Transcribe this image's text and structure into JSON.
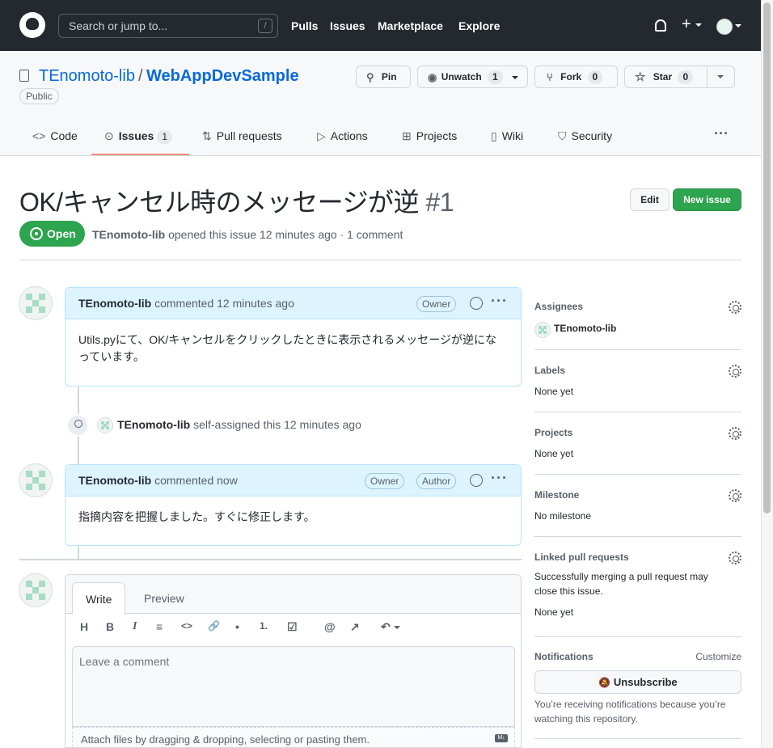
{
  "topnav": {
    "search_placeholder": "Search or jump to...",
    "search_shortcut": "/",
    "links": [
      "Pulls",
      "Issues",
      "Marketplace",
      "Explore"
    ],
    "plus": "+"
  },
  "repo": {
    "owner": "TEnomoto-lib",
    "separator": "/",
    "name": "WebAppDevSample",
    "visibility": "Public",
    "pin_label": "Pin",
    "unwatch_label": "Unwatch",
    "watch_count": "1",
    "fork_label": "Fork",
    "fork_count": "0",
    "star_label": "Star",
    "star_count": "0"
  },
  "tabs": [
    {
      "label": "Code",
      "icon": "code-icon"
    },
    {
      "label": "Issues",
      "icon": "issue-icon",
      "count": "1"
    },
    {
      "label": "Pull requests",
      "icon": "pull-request-icon"
    },
    {
      "label": "Actions",
      "icon": "play-icon"
    },
    {
      "label": "Projects",
      "icon": "table-icon"
    },
    {
      "label": "Wiki",
      "icon": "book-icon"
    },
    {
      "label": "Security",
      "icon": "shield-icon"
    }
  ],
  "more": "···",
  "issue": {
    "title": "OK/キャンセル時のメッセージが逆",
    "number": "#1",
    "edit_label": "Edit",
    "new_issue_label": "New issue",
    "state": "Open",
    "author": "TEnomoto-lib",
    "meta_text": "opened this issue 12 minutes ago · 1 comment"
  },
  "comments": [
    {
      "author": "TEnomoto-lib",
      "action": "commented 12 minutes ago",
      "badges": [
        "Owner"
      ],
      "body_line1": "Utils.pyにて、OK/キャンセルをクリックしたときに表示されるメッセージが逆にな",
      "body_line2": "っています。"
    },
    {
      "author": "TEnomoto-lib",
      "action": "commented now",
      "badges": [
        "Owner",
        "Author"
      ],
      "body_line1": "指摘内容を把握しました。すぐに修正します。"
    }
  ],
  "event": {
    "actor": "TEnomoto-lib",
    "text": "self-assigned this 12 minutes ago"
  },
  "editor": {
    "write_tab": "Write",
    "preview_tab": "Preview",
    "toolbar": [
      "H",
      "B",
      "I",
      "≡",
      "<>",
      "🔗",
      "•",
      "1.",
      "☑",
      "@",
      "↗",
      "↶"
    ],
    "placeholder": "Leave a comment",
    "attach_text": "Attach files by dragging & dropping, selecting or pasting them.",
    "md_badge": "M↓"
  },
  "sidebar": {
    "assignees_title": "Assignees",
    "assignee": "TEnomoto-lib",
    "labels_title": "Labels",
    "labels_value": "None yet",
    "projects_title": "Projects",
    "projects_value": "None yet",
    "milestone_title": "Milestone",
    "milestone_value": "No milestone",
    "linked_title": "Linked pull requests",
    "linked_desc_1": "Successfully merging a pull request may",
    "linked_desc_2": "close this issue.",
    "linked_value": "None yet",
    "notifications_title": "Notifications",
    "customize": "Customize",
    "unsubscribe": "Unsubscribe",
    "notif_desc_1": "You’re receiving notifications because you’re",
    "notif_desc_2": "watching this repository."
  },
  "colors": {
    "header_bg": "#24292f",
    "open_green": "#2da44e",
    "link_blue": "#0969da",
    "comment_header_bg": "#ddf4ff",
    "tab_underline": "#fd8c73"
  }
}
